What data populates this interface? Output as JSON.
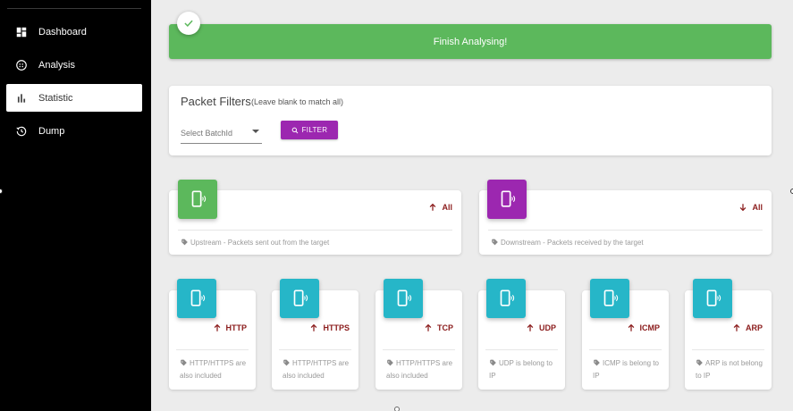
{
  "sidebar": {
    "items": [
      {
        "label": "Dashboard",
        "icon": "dashboard-icon",
        "active": false
      },
      {
        "label": "Analysis",
        "icon": "globe-icon",
        "active": false
      },
      {
        "label": "Statistic",
        "icon": "bar-chart-icon",
        "active": true
      },
      {
        "label": "Dump",
        "icon": "history-icon",
        "active": false
      }
    ]
  },
  "banner": {
    "text": "Finish Analysing!",
    "color": "#5cb85c"
  },
  "filters": {
    "title": "Packet Filters",
    "hint": "(Leave blank to match all)",
    "select_placeholder": "Select BatchId",
    "filter_label": "FILTER",
    "button_color": "#9c27b0"
  },
  "summary": [
    {
      "label": "All",
      "direction": "up",
      "footer": "Upstream - Packets sent out from the target",
      "color": "#5cb85c"
    },
    {
      "label": "All",
      "direction": "down",
      "footer": "Downstream - Packets received by the target",
      "color": "#9c27b0"
    }
  ],
  "protocols": [
    {
      "label": "HTTP",
      "direction": "up",
      "footer": "HTTP/HTTPS are also included"
    },
    {
      "label": "HTTPS",
      "direction": "up",
      "footer": "HTTP/HTTPS are also included"
    },
    {
      "label": "TCP",
      "direction": "up",
      "footer": "HTTP/HTTPS are also included"
    },
    {
      "label": "UDP",
      "direction": "up",
      "footer": "UDP is belong to IP"
    },
    {
      "label": "ICMP",
      "direction": "up",
      "footer": "ICMP is belong to IP"
    },
    {
      "label": "ARP",
      "direction": "up",
      "footer": "ARP is not belong to IP"
    }
  ],
  "colors": {
    "tile_cyan": "#26b6c8",
    "stat_red": "#8b1c1c"
  }
}
